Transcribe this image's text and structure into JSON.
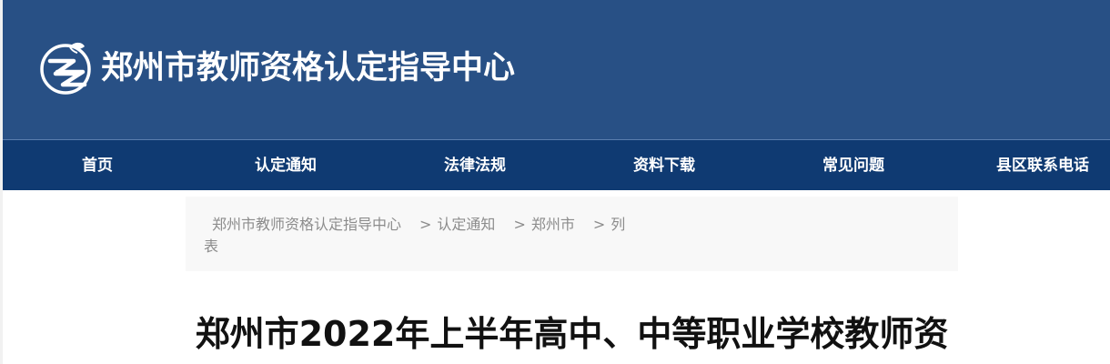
{
  "header": {
    "site_title": "郑州市教师资格认定指导中心",
    "logo_icon": "zz-logo-icon",
    "background_color": "#285085"
  },
  "nav": {
    "background_color": "#0f3a72",
    "items": [
      {
        "label": "首页"
      },
      {
        "label": "认定通知"
      },
      {
        "label": "法律法规"
      },
      {
        "label": "资料下载"
      },
      {
        "label": "常见问题"
      },
      {
        "label": "县区联系电话"
      }
    ]
  },
  "breadcrumb": {
    "items": [
      {
        "label": "郑州市教师资格认定指导中心"
      },
      {
        "label": "认定通知"
      },
      {
        "label": "郑州市"
      },
      {
        "label": "列表"
      }
    ],
    "separator": ">"
  },
  "article": {
    "title_line1": "郑州市2022年上半年高中、中等职业学校教师资"
  }
}
